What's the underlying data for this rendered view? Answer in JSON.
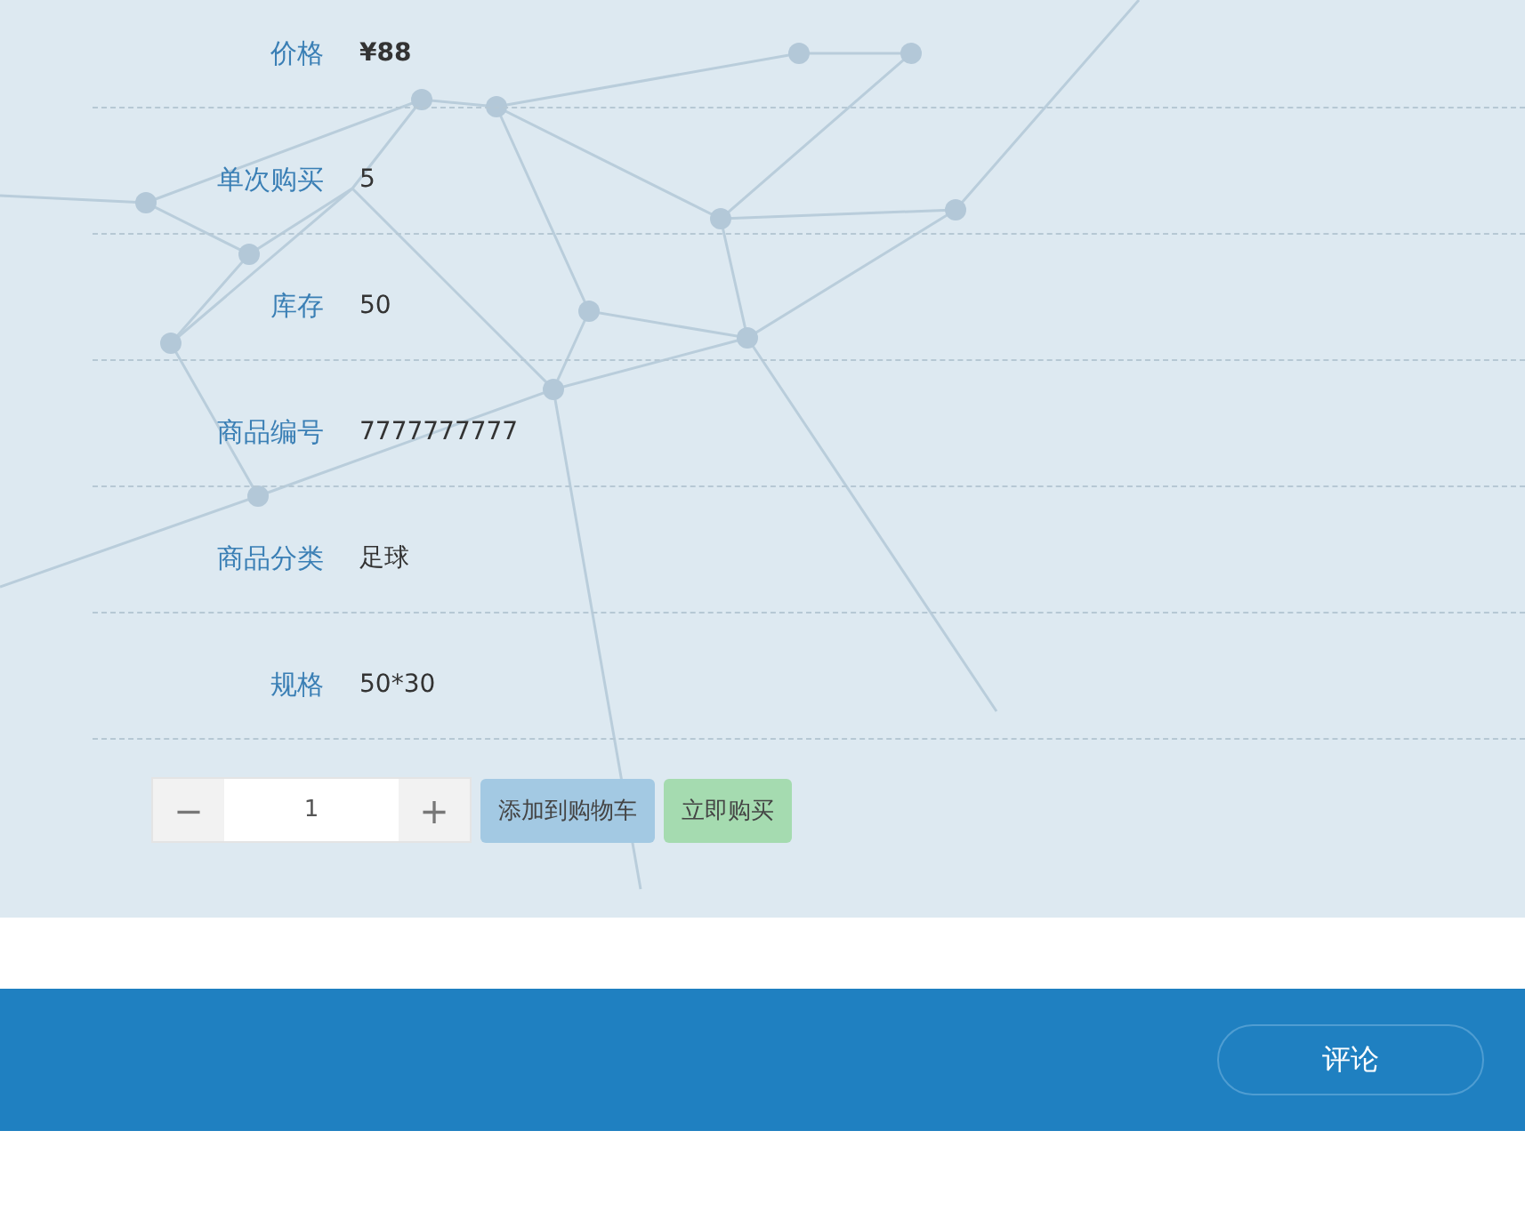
{
  "details": [
    {
      "label": "价格",
      "value": "¥88",
      "kind": "price"
    },
    {
      "label": "单次购买",
      "value": "5",
      "kind": "text"
    },
    {
      "label": "库存",
      "value": "50",
      "kind": "text"
    },
    {
      "label": "商品编号",
      "value": "7777777777",
      "kind": "text"
    },
    {
      "label": "商品分类",
      "value": "足球",
      "kind": "text"
    },
    {
      "label": "规格",
      "value": "50*30",
      "kind": "text"
    }
  ],
  "quantity": {
    "decrease": "−",
    "value": "1",
    "increase": "+"
  },
  "actions": [
    {
      "label": "添加到购物车",
      "kind": "cart"
    },
    {
      "label": "立即购买",
      "kind": "buy"
    }
  ],
  "footer": {
    "button": "评论"
  }
}
